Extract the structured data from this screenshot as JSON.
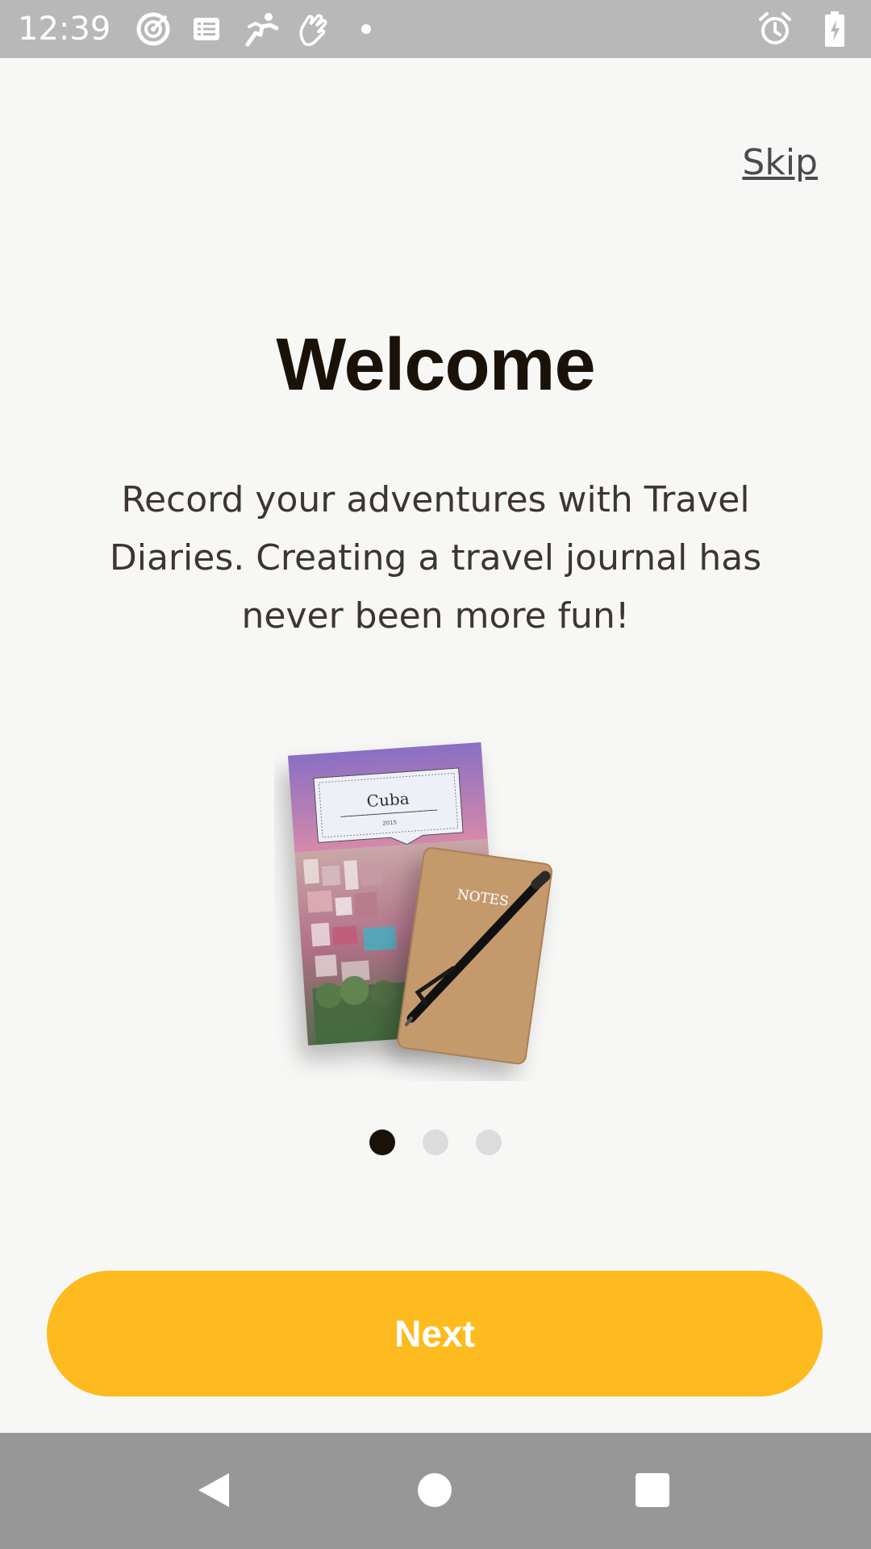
{
  "status_bar": {
    "time": "12:39",
    "left_icons": [
      "target-icon",
      "list-icon",
      "runner-icon",
      "hand-icon",
      "dot-icon"
    ],
    "right_icons": [
      "alarm-icon",
      "battery-charging-icon"
    ]
  },
  "onboarding": {
    "skip_label": "Skip",
    "title": "Welcome",
    "description": "Record your adventures with Travel Diaries. Creating a travel journal has never been more fun!",
    "illustration": {
      "book_cover_title": "Cuba",
      "book_cover_year": "2015",
      "notebook_label": "NOTES"
    },
    "page_indicator": {
      "current": 1,
      "total": 3
    },
    "next_label": "Next"
  },
  "colors": {
    "accent": "#fdbb20",
    "background": "#f7f7f6",
    "title": "#1a1208",
    "dot_active": "#1a1208",
    "dot_inactive": "#dcdcdc"
  },
  "nav_bar": {
    "buttons": [
      "back-icon",
      "home-icon",
      "recents-icon"
    ]
  }
}
